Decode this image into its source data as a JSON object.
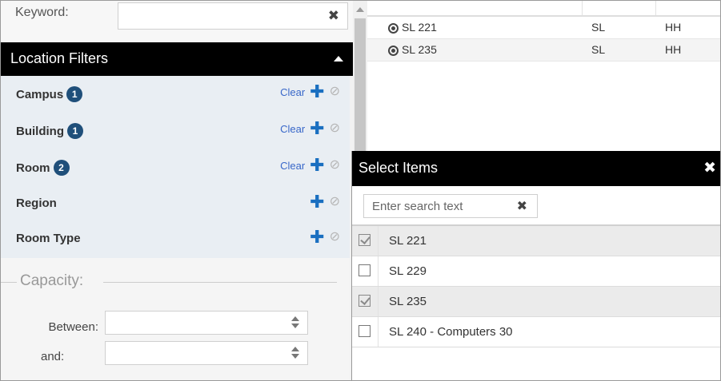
{
  "keyword": {
    "label": "Keyword:",
    "value": "",
    "clear_icon": "times-icon"
  },
  "location_filters": {
    "title": "Location Filters",
    "items": [
      {
        "label": "Campus",
        "badge": "1",
        "clear": "Clear",
        "show_clear": true
      },
      {
        "label": "Building",
        "badge": "1",
        "clear": "Clear",
        "show_clear": true
      },
      {
        "label": "Room",
        "badge": "2",
        "clear": "Clear",
        "show_clear": true
      },
      {
        "label": "Region",
        "badge": "",
        "clear": "",
        "show_clear": false
      },
      {
        "label": "Room Type",
        "badge": "",
        "clear": "",
        "show_clear": false
      }
    ]
  },
  "capacity": {
    "legend": "Capacity:",
    "between_label": "Between:",
    "and_label": "and:",
    "between_value": "",
    "and_value": ""
  },
  "results": {
    "rows": [
      {
        "name": "SL 221",
        "col2": "SL",
        "col3": "HH"
      },
      {
        "name": "SL 235",
        "col2": "SL",
        "col3": "HH"
      }
    ]
  },
  "dialog": {
    "title": "Select Items",
    "search_placeholder": "Enter search text",
    "items": [
      {
        "label": "SL 221",
        "checked": true
      },
      {
        "label": "SL 229",
        "checked": false
      },
      {
        "label": "SL 235",
        "checked": true
      },
      {
        "label": "SL 240 - Computers 30",
        "checked": false
      }
    ]
  },
  "colors": {
    "header_bg": "#000000",
    "badge_bg": "#1f4f7a",
    "plus": "#1a6fc0",
    "link": "#3867c9",
    "filter_bg": "#e9eef3"
  }
}
